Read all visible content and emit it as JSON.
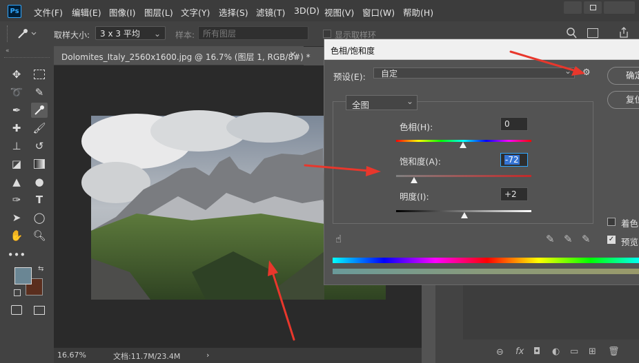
{
  "app": {
    "logo": "Ps"
  },
  "menu": [
    "文件(F)",
    "编辑(E)",
    "图像(I)",
    "图层(L)",
    "文字(Y)",
    "选择(S)",
    "滤镜(T)",
    "3D(D)",
    "视图(V)",
    "窗口(W)",
    "帮助(H)"
  ],
  "options": {
    "sample_size_label": "取样大小:",
    "sample_size_value": "3 x 3 平均",
    "sample_label": "样本:",
    "sample_value": "所有图层",
    "show_ring_label": "显示取样环"
  },
  "document": {
    "tab_title": "Dolomites_Italy_2560x1600.jpg @ 16.7% (图层 1, RGB/8#) *",
    "close_glyph": "×",
    "zoom": "16.67%",
    "doc_size": "文档:11.7M/23.4M",
    "status_arrow": "›"
  },
  "dialog": {
    "title": "色相/饱和度",
    "preset_label": "预设(E):",
    "preset_value": "自定",
    "channel": "全图",
    "hue_label": "色相(H):",
    "hue_value": "0",
    "saturation_label": "饱和度(A):",
    "saturation_value": "-72",
    "lightness_label": "明度(I):",
    "lightness_value": "+2",
    "ok_label": "确定",
    "reset_label": "复位",
    "colorize_label": "着色",
    "preview_label": "预览",
    "colorize_checked": false,
    "preview_checked": true
  },
  "toolbar": {
    "foreground_color": "#6a8694",
    "background_color": "#5a2e1e"
  },
  "colors": {
    "arrow": "#e8372c",
    "accent": "#31a8ff"
  }
}
